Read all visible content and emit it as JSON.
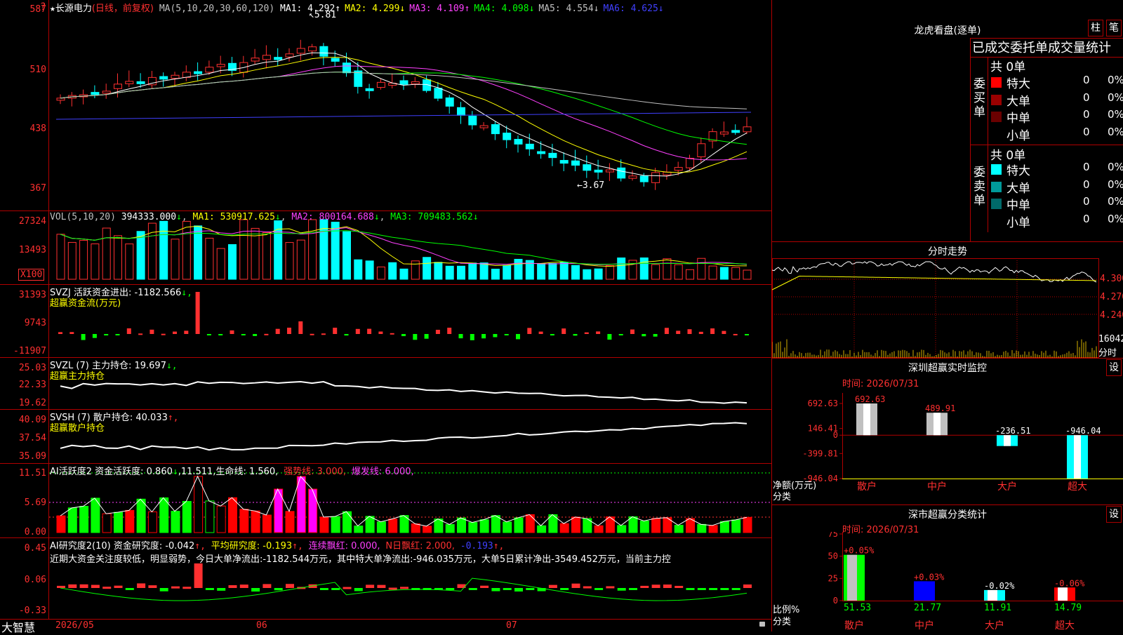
{
  "stock": {
    "name": "长源电力",
    "mode": "(日线，前复权)",
    "ma_label": "MA(5,10,20,30,60,120)",
    "ma": [
      {
        "label": "MA1:",
        "value": "4.292",
        "arrow": "↑",
        "color": "#ffffff"
      },
      {
        "label": "MA2:",
        "value": "4.299",
        "arrow": "↓",
        "color": "#ffff00"
      },
      {
        "label": "MA3:",
        "value": "4.109",
        "arrow": "↑",
        "color": "#ff40ff"
      },
      {
        "label": "MA4:",
        "value": "4.098",
        "arrow": "↓",
        "color": "#00ff00"
      },
      {
        "label": "MA5:",
        "value": "4.554",
        "arrow": "↓",
        "color": "#c0c0c0"
      },
      {
        "label": "MA6:",
        "value": "4.625",
        "arrow": "↓",
        "color": "#4040ff"
      }
    ],
    "high_mark": "5.81",
    "low_mark": "3.67",
    "star": "★",
    "help": "?"
  },
  "price_axis": [
    "587",
    "510",
    "438",
    "367"
  ],
  "vol": {
    "label": "VOL(5,10,20)",
    "value": "394333.000",
    "value_arrow": "↓",
    "ma1": "MA1: 530917.625",
    "ma1_arrow": "↓",
    "ma2": "MA2: 800164.688",
    "ma2_arrow": "↓",
    "ma3": "MA3: 709483.562",
    "ma3_arrow": "↓",
    "axis": [
      "27324",
      "13493"
    ],
    "unit": "X100"
  },
  "svzj": {
    "label": "SVZJ  活跃资金进出: -1182.566",
    "arrow": "↓,",
    "sub": "超赢资金流(万元)",
    "axis": [
      "31393",
      "9743",
      "-11907"
    ]
  },
  "svzl": {
    "label": "SVZL (7) 主力持仓: 19.697",
    "arrow": "↓,",
    "sub": "超赢主力持仓",
    "axis": [
      "25.03",
      "22.33",
      "19.62"
    ]
  },
  "svsh": {
    "label": "SVSH (7) 散户持仓: 40.033",
    "arrow": "↑,",
    "sub": "超赢散户持仓",
    "axis": [
      "40.09",
      "37.54",
      "35.09"
    ]
  },
  "ai_act": {
    "p1": "AI活跃度2 资金活跃度: 0.860",
    "p1_arrow": "↓",
    "p2": ",11.511,生命线: 1.560,",
    "p3": "强势线: 3.000,",
    "p4": "爆发线: 6.000,",
    "axis": [
      "11.51",
      "5.69",
      "0.00"
    ]
  },
  "ai_res": {
    "p1": "AI研究度2(10) 资金研究度: -0.042",
    "p1_arrow": "↑,",
    "p2": "平均研究度: -0.193",
    "p2_arrow": "↑,",
    "p3": "连续飘红: 0.000,",
    "p4": "N日飘红: 2.000,",
    "p5": "-0.193",
    "p5_arrow": "↑,",
    "summary": "近期大资金关注度较低，明显弱势，今日大单净流出:-1182.544万元，其中特大单净流出:-946.035万元，大单5日累计净出-3549.452万元，当前主力控",
    "axis": [
      "0.45",
      "0.06",
      "-0.33"
    ]
  },
  "footer": {
    "brand": "大智慧",
    "dates": [
      "2026/05",
      "06",
      "07"
    ]
  },
  "dragon": {
    "title": "龙虎看盘(逐单)",
    "btn1": "柱",
    "btn2": "笔",
    "subtitle": "已成交委托单成交量统计",
    "buy_label": "委买单",
    "sell_label": "委卖单",
    "buy_total": "共 0单",
    "sell_total": "共 0单",
    "buy_rows": [
      {
        "name": "特大",
        "qty": "0",
        "pct": "0%",
        "color": "#ff0000"
      },
      {
        "name": "大单",
        "qty": "0",
        "pct": "0%",
        "color": "#9a0000"
      },
      {
        "name": "中单",
        "qty": "0",
        "pct": "0%",
        "color": "#6a0000"
      },
      {
        "name": "小单",
        "qty": "0",
        "pct": "0%",
        "color": "#000000"
      }
    ],
    "sell_rows": [
      {
        "name": "特大",
        "qty": "0",
        "pct": "0%",
        "color": "#00ffff"
      },
      {
        "name": "大单",
        "qty": "0",
        "pct": "0%",
        "color": "#009a9a"
      },
      {
        "name": "中单",
        "qty": "0",
        "pct": "0%",
        "color": "#006a6a"
      },
      {
        "name": "小单",
        "qty": "0",
        "pct": "0%",
        "color": "#000000"
      }
    ]
  },
  "intraday": {
    "title": "分时走势",
    "axis": [
      "4.300",
      "4.270",
      "4.240"
    ],
    "vol_value": "16042",
    "vol_label": "分时"
  },
  "sz_monitor": {
    "title": "深圳超赢实时监控",
    "settings": "设",
    "time": "时间: 2026/07/31",
    "axis": [
      "692.63",
      "146.41",
      "0",
      "-399.81",
      "-946.04"
    ],
    "ylabel": "净额(万元)",
    "xlabel": "分类",
    "chart_data": {
      "type": "bar",
      "categories": [
        "散户",
        "中户",
        "大户",
        "超大"
      ],
      "values": [
        692.63,
        489.91,
        -236.51,
        -946.04
      ],
      "labels": [
        "692.63",
        "489.91",
        "-236.51",
        "-946.04"
      ],
      "ylim": [
        -946.04,
        692.63
      ]
    }
  },
  "sz_class": {
    "title": "深市超赢分类统计",
    "settings": "设",
    "time": "时间: 2026/07/31",
    "axis": [
      "75",
      "50",
      "25",
      "0"
    ],
    "ylabel": "比例%",
    "xlabel": "分类",
    "chart_data": {
      "type": "bar",
      "categories": [
        "散户",
        "中户",
        "大户",
        "超大"
      ],
      "values": [
        51.53,
        21.77,
        11.91,
        14.79
      ],
      "changes": [
        "+0.05%",
        "+0.03%",
        "-0.02%",
        "-0.06%"
      ],
      "value_labels": [
        "51.53",
        "21.77",
        "11.91",
        "14.79"
      ],
      "colors": [
        "#00ff00",
        "#0000ff",
        "#00ffff",
        "#ff0000"
      ],
      "ylim": [
        0,
        75
      ]
    }
  }
}
